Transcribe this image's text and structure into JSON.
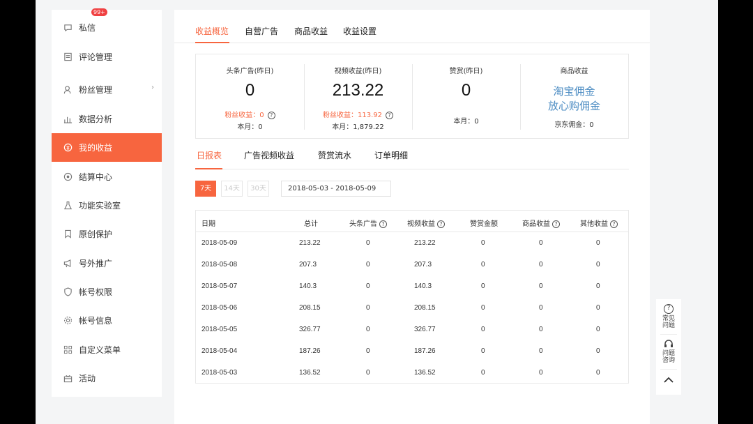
{
  "sidebar": {
    "items": [
      {
        "label": "私信",
        "icon": "message-icon",
        "badge": "99+"
      },
      {
        "label": "评论管理",
        "icon": "comment-icon"
      },
      {
        "label": "粉丝管理",
        "icon": "fans-icon",
        "chevron": "›"
      },
      {
        "label": "数据分析",
        "icon": "bar-chart-icon"
      },
      {
        "label": "我的收益",
        "icon": "income-icon",
        "active": true
      },
      {
        "label": "结算中心",
        "icon": "settlement-icon"
      },
      {
        "label": "功能实验室",
        "icon": "flask-icon"
      },
      {
        "label": "原创保护",
        "icon": "bookmark-icon"
      },
      {
        "label": "号外推广",
        "icon": "megaphone-icon"
      },
      {
        "label": "帐号权限",
        "icon": "shield-icon"
      },
      {
        "label": "帐号信息",
        "icon": "gear-icon"
      },
      {
        "label": "自定义菜单",
        "icon": "grid-icon"
      },
      {
        "label": "活动",
        "icon": "gift-icon"
      }
    ]
  },
  "tabs": [
    "收益概览",
    "自营广告",
    "商品收益",
    "收益设置"
  ],
  "cards": {
    "ads": {
      "title": "头条广告(昨日)",
      "value": "0",
      "fans": "粉丝收益：0",
      "month": "本月：0"
    },
    "video": {
      "title": "视频收益(昨日)",
      "value": "213.22",
      "fans": "粉丝收益：113.92",
      "month": "本月：1,879.22"
    },
    "reward": {
      "title": "赞赏(昨日)",
      "value": "0",
      "month": "本月：0"
    },
    "goods": {
      "title": "商品收益",
      "link1": "淘宝佣金",
      "link2": "放心购佣金",
      "jd": "京东佣金：0"
    }
  },
  "subtabs": [
    "日报表",
    "广告视频收益",
    "赞赏流水",
    "订单明细"
  ],
  "ranges": [
    "7天",
    "14天",
    "30天"
  ],
  "date_range": "2018-05-03  -  2018-05-09",
  "table": {
    "headers": [
      "日期",
      "总计",
      "头条广告",
      "视频收益",
      "赞赏金额",
      "商品收益",
      "其他收益"
    ],
    "rows": [
      [
        "2018-05-09",
        "213.22",
        "0",
        "213.22",
        "0",
        "0",
        "0"
      ],
      [
        "2018-05-08",
        "207.3",
        "0",
        "207.3",
        "0",
        "0",
        "0"
      ],
      [
        "2018-05-07",
        "140.3",
        "0",
        "140.3",
        "0",
        "0",
        "0"
      ],
      [
        "2018-05-06",
        "208.15",
        "0",
        "208.15",
        "0",
        "0",
        "0"
      ],
      [
        "2018-05-05",
        "326.77",
        "0",
        "326.77",
        "0",
        "0",
        "0"
      ],
      [
        "2018-05-04",
        "187.26",
        "0",
        "187.26",
        "0",
        "0",
        "0"
      ],
      [
        "2018-05-03",
        "136.52",
        "0",
        "136.52",
        "0",
        "0",
        "0"
      ]
    ]
  },
  "help": {
    "faq": "常见问题",
    "consult": "问题咨询"
  },
  "colors": {
    "accent": "#f7653f",
    "link": "#4a8bc2",
    "badge": "#f04142"
  }
}
